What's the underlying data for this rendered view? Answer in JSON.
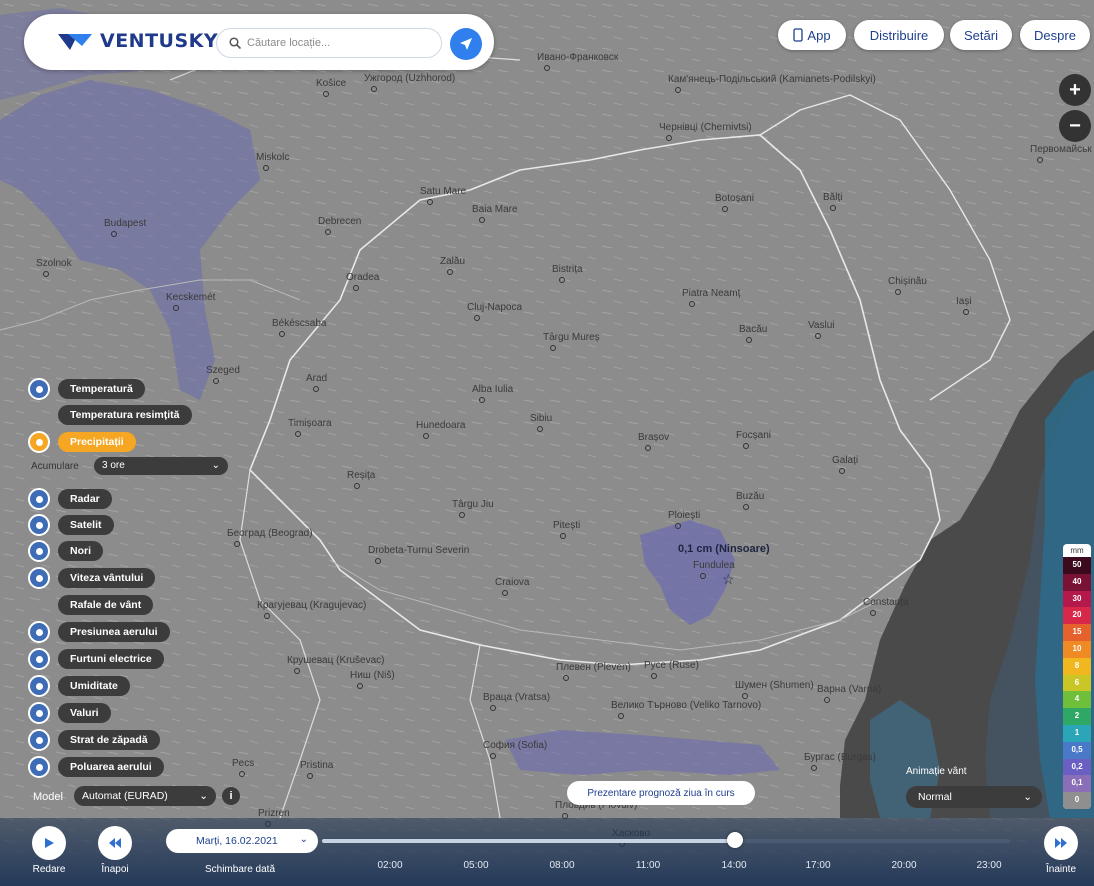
{
  "app": {
    "logo_text": "VENTUSKY"
  },
  "search": {
    "placeholder": "Căutare locație..."
  },
  "top_buttons": [
    "App",
    "Distribuire",
    "Setări",
    "Despre"
  ],
  "layers": [
    {
      "label": "Temperatură",
      "icon": "thermometer-icon",
      "active": false
    },
    {
      "label": "Temperatura resimțită",
      "icon": "",
      "active": false
    },
    {
      "label": "Precipitații",
      "icon": "droplet-icon",
      "active": true
    },
    {
      "label": "Radar",
      "icon": "radar-icon",
      "active": false
    },
    {
      "label": "Satelit",
      "icon": "satellite-icon",
      "active": false
    },
    {
      "label": "Nori",
      "icon": "cloud-icon",
      "active": false
    },
    {
      "label": "Viteza vântului",
      "icon": "wind-icon",
      "active": false
    },
    {
      "label": "Rafale de vânt",
      "icon": "",
      "active": false
    },
    {
      "label": "Presiunea aerului",
      "icon": "pressure-icon",
      "active": false
    },
    {
      "label": "Furtuni electrice",
      "icon": "lightning-icon",
      "active": false
    },
    {
      "label": "Umiditate",
      "icon": "humidity-icon",
      "active": false
    },
    {
      "label": "Valuri",
      "icon": "wave-icon",
      "active": false
    },
    {
      "label": "Strat de zăpadă",
      "icon": "snowflake-icon",
      "active": false
    },
    {
      "label": "Poluarea aerului",
      "icon": "factory-icon",
      "active": false
    }
  ],
  "accumulation": {
    "label": "Acumulare",
    "value": "3 ore"
  },
  "model": {
    "label": "Model",
    "value": "Automat (EURAD)"
  },
  "info_label": "i",
  "forecast_button": "Prezentare prognoză ziua în curs",
  "wind_animation": {
    "label": "Animație vânt",
    "value": "Normal"
  },
  "legend": {
    "unit": "mm",
    "steps": [
      {
        "value": "50",
        "color": "#3b0a1f"
      },
      {
        "value": "40",
        "color": "#7a1236"
      },
      {
        "value": "30",
        "color": "#b5184a"
      },
      {
        "value": "20",
        "color": "#d8284a"
      },
      {
        "value": "15",
        "color": "#e5622d"
      },
      {
        "value": "10",
        "color": "#f08a24"
      },
      {
        "value": "8",
        "color": "#f1b71f"
      },
      {
        "value": "6",
        "color": "#c9c625"
      },
      {
        "value": "4",
        "color": "#6fbf3a"
      },
      {
        "value": "2",
        "color": "#2fa866"
      },
      {
        "value": "1",
        "color": "#2ba6b8"
      },
      {
        "value": "0,5",
        "color": "#4a79c9"
      },
      {
        "value": "0,2",
        "color": "#6a5fc2"
      },
      {
        "value": "0,1",
        "color": "#8a6fb8"
      },
      {
        "value": "0",
        "color": "#8f8f8f"
      }
    ]
  },
  "timeline": {
    "play_label": "Redare",
    "back_label": "Înapoi",
    "forward_label": "Înainte",
    "date": "Marți, 16.02.2021",
    "change_date_label": "Schimbare dată",
    "times": [
      "02:00",
      "05:00",
      "08:00",
      "11:00",
      "14:00",
      "17:00",
      "20:00",
      "23:00"
    ],
    "progress": 0.6
  },
  "map": {
    "labels": [
      {
        "t": "Košice",
        "c": "Ко̌ice"
      },
      {
        "t": "Baia Mare"
      },
      {
        "t": "Satu Mare"
      },
      {
        "t": "Debrecen"
      },
      {
        "t": "Oradea"
      },
      {
        "t": "Cluj-Napoca"
      },
      {
        "t": "Zalău"
      },
      {
        "t": "Bistrița"
      },
      {
        "t": "Târgu Mureș"
      },
      {
        "t": "Piatra Neamț"
      },
      {
        "t": "Botoșani"
      },
      {
        "t": "Bălți"
      },
      {
        "t": "Bacău"
      },
      {
        "t": "Vaslui"
      },
      {
        "t": "Chișinău"
      },
      {
        "t": "Iași"
      },
      {
        "t": "Békéscsaba"
      },
      {
        "t": "Szeged"
      },
      {
        "t": "Arad"
      },
      {
        "t": "Timișoara"
      },
      {
        "t": "Alba Iulia"
      },
      {
        "t": "Hunedoara"
      },
      {
        "t": "Sibiu"
      },
      {
        "t": "Brașov"
      },
      {
        "t": "Focșani"
      },
      {
        "t": "Galați"
      },
      {
        "t": "Buzău"
      },
      {
        "t": "Ploiești"
      },
      {
        "t": "Pitești"
      },
      {
        "t": "Târgu Jiu"
      },
      {
        "t": "Reșița"
      },
      {
        "t": "Drobeta-Turnu Severin"
      },
      {
        "t": "Craiova"
      },
      {
        "t": "Fundulea"
      },
      {
        "t": "Constanța"
      },
      {
        "t": "Budapest"
      },
      {
        "t": "Kecskemét"
      },
      {
        "t": "Miskolc"
      },
      {
        "t": "Szolnok"
      },
      {
        "t": "Београд (Beograd)"
      },
      {
        "t": "Крагујевац (Kragujevac)"
      },
      {
        "t": "Крушевац (Kruševac)"
      },
      {
        "t": "Ниш (Niš)"
      },
      {
        "t": "Плевен (Pleven)"
      },
      {
        "t": "Враца (Vratsa)"
      },
      {
        "t": "Велико Търново (Veliko Tarnovo)"
      },
      {
        "t": "Шумен (Shumen)"
      },
      {
        "t": "Варна (Varna)"
      },
      {
        "t": "Бургас (Burgas)"
      },
      {
        "t": "София (Sofia)"
      },
      {
        "t": "Пловдив (Plovdiv)"
      },
      {
        "t": "Русе (Ruse)"
      },
      {
        "t": "Хасково"
      },
      {
        "t": "Ужгород (Uzhhorod)"
      },
      {
        "t": "Чернівці (Chernivtsi)"
      },
      {
        "t": "Кам'янець-Подільський (Kamianets-Podilskyi)"
      },
      {
        "t": "Ивано-Франковск"
      },
      {
        "t": "Первомайськ (Pervomaysk)"
      },
      {
        "t": "Pristina"
      },
      {
        "t": "Prizren"
      },
      {
        "t": "Pecs"
      }
    ],
    "marker_label": "0,1 cm (Ninsoare)"
  }
}
